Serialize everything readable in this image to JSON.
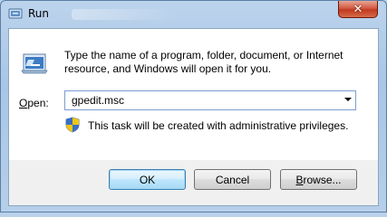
{
  "window": {
    "title": "Run",
    "close_glyph": "✕",
    "icon": "run-app-icon"
  },
  "dialog": {
    "description": "Type the name of a program, folder, document, or Internet resource, and Windows will open it for you.",
    "open_label_prefix": "O",
    "open_label_rest": "pen:",
    "open_value": "gpedit.msc",
    "admin_note": "This task will be created with administrative privileges."
  },
  "buttons": {
    "ok": "OK",
    "cancel": "Cancel",
    "browse_prefix": "B",
    "browse_rest": "rowse..."
  },
  "colors": {
    "close_red": "#c1391e",
    "client_bg": "#f0f0f0",
    "frame_blue": "#a9c6e6"
  }
}
